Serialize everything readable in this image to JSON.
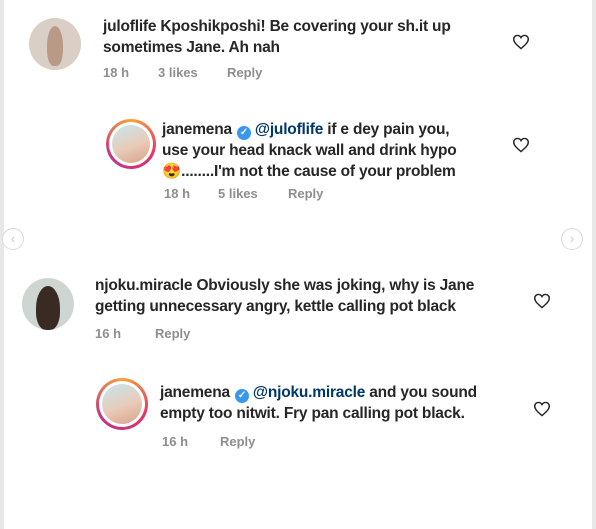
{
  "comments": [
    {
      "username": "juloflife",
      "text": "Kposhikposhi! Be covering your sh.it up sometimes Jane. Ah nah",
      "time": "18 h",
      "likes": "3 likes",
      "reply": "Reply"
    },
    {
      "username": "janemena",
      "mention": "@juloflife",
      "text_line1_rest": " if e dey pain you,",
      "text_line2": "use your head knack wall and drink hypo",
      "emoji": "😍",
      "text_line3": "........I'm not the cause of your problem",
      "time": "18 h",
      "likes": "5 likes",
      "reply": "Reply"
    },
    {
      "username": "njoku.miracle",
      "text": "Obviously she was joking, why is Jane getting unnecessary angry, kettle calling pot black",
      "time": "16 h",
      "reply": "Reply"
    },
    {
      "username": "janemena",
      "mention": "@njoku.miracle",
      "text_line1_rest": " and you sound",
      "text_line2": "empty too nitwit. Fry pan calling pot black.",
      "time": "16 h",
      "reply": "Reply"
    }
  ],
  "verified_glyph": "✓",
  "nav": {
    "prev": "‹",
    "next": "›"
  },
  "colors": {
    "text": "#262626",
    "meta": "#8e8e8e",
    "mention": "#00376b",
    "verified": "#3897f0"
  }
}
